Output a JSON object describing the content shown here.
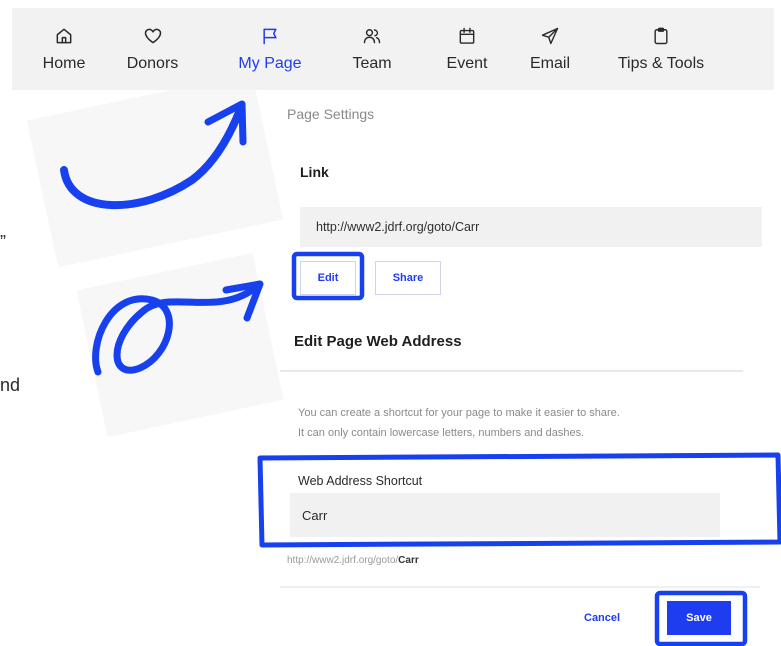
{
  "nav": {
    "items": [
      {
        "label": "Home",
        "icon": "home-icon"
      },
      {
        "label": "Donors",
        "icon": "heart-icon"
      },
      {
        "label": "My Page",
        "icon": "flag-icon",
        "active": true
      },
      {
        "label": "Team",
        "icon": "people-icon"
      },
      {
        "label": "Event",
        "icon": "calendar-icon"
      },
      {
        "label": "Email",
        "icon": "send-icon"
      },
      {
        "label": "Tips & Tools",
        "icon": "clipboard-icon"
      }
    ]
  },
  "left_fragments": [
    "”",
    "nd"
  ],
  "page_settings": {
    "section_label": "Page Settings",
    "link": {
      "title": "Link",
      "url": "http://www2.jdrf.org/goto/Carr",
      "edit_label": "Edit",
      "share_label": "Share"
    },
    "edit_address": {
      "title": "Edit Page Web Address",
      "description_line1": "You can create a shortcut for your page to make it easier to share.",
      "description_line2": "It can only contain lowercase letters, numbers and dashes.",
      "field_label": "Web Address Shortcut",
      "field_value": "Carr",
      "preview_prefix": "http://www2.jdrf.org/goto/",
      "preview_value": "Carr",
      "cancel_label": "Cancel",
      "save_label": "Save"
    }
  },
  "colors": {
    "accent": "#1f3df0",
    "annotation": "#1740ee",
    "nav_bg": "#f2f2f2",
    "field_bg": "#f1f1f1"
  }
}
